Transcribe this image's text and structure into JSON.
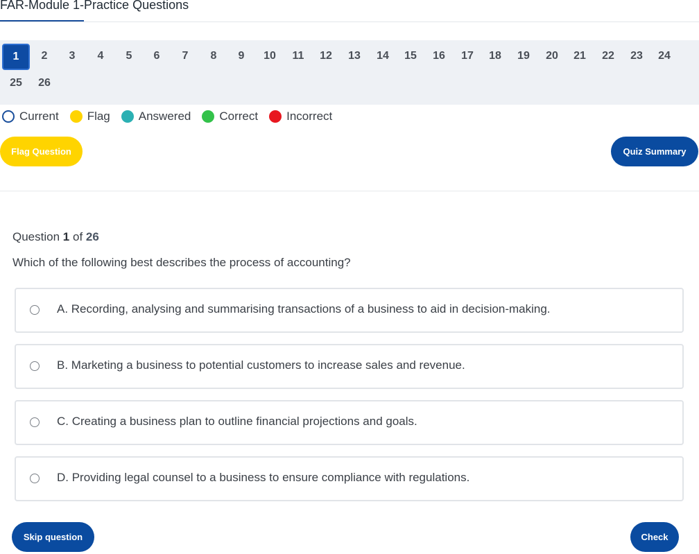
{
  "tab": {
    "title": "FAR-Module 1-Practice Questions"
  },
  "navigator": {
    "numbers": [
      "1",
      "2",
      "3",
      "4",
      "5",
      "6",
      "7",
      "8",
      "9",
      "10",
      "11",
      "12",
      "13",
      "14",
      "15",
      "16",
      "17",
      "18",
      "19",
      "20",
      "21",
      "22",
      "23",
      "24",
      "25",
      "26"
    ],
    "current": "1"
  },
  "legend": {
    "items": [
      {
        "label": "Current",
        "color": "#ffffff"
      },
      {
        "label": "Flag",
        "color": "#ffd400"
      },
      {
        "label": "Answered",
        "color": "#2bb0b3"
      },
      {
        "label": "Correct",
        "color": "#33c24a"
      },
      {
        "label": "Incorrect",
        "color": "#e8171f"
      }
    ]
  },
  "actions": {
    "flag_label": "Flag Question",
    "summary_label": "Quiz Summary"
  },
  "question": {
    "prefix": "Question",
    "number": "1",
    "of_word": "of",
    "total": "26",
    "text": "Which of the following best describes the process of accounting?",
    "options": [
      "A. Recording, analysing and summarising transactions of a business to aid in decision-making.",
      "B. Marketing a business to potential customers to increase sales and revenue.",
      "C. Creating a business plan to outline financial projections and goals.",
      "D. Providing legal counsel to a business to ensure compliance with regulations."
    ]
  },
  "footer": {
    "skip_label": "Skip question",
    "check_label": "Check"
  }
}
